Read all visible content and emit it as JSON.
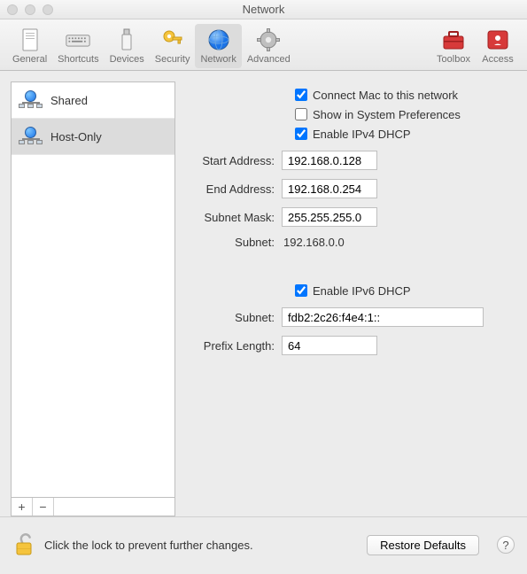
{
  "window": {
    "title": "Network"
  },
  "toolbar": {
    "items": [
      {
        "label": "General"
      },
      {
        "label": "Shortcuts"
      },
      {
        "label": "Devices"
      },
      {
        "label": "Security"
      },
      {
        "label": "Network"
      },
      {
        "label": "Advanced"
      }
    ],
    "right": [
      {
        "label": "Toolbox"
      },
      {
        "label": "Access"
      }
    ]
  },
  "sidebar": {
    "items": [
      {
        "label": "Shared"
      },
      {
        "label": "Host-Only"
      }
    ],
    "add": "+",
    "remove": "−"
  },
  "checkboxes": {
    "connect_mac": "Connect Mac to this network",
    "show_sysprefs": "Show in System Preferences",
    "enable_ipv4": "Enable IPv4 DHCP",
    "enable_ipv6": "Enable IPv6 DHCP"
  },
  "labels": {
    "start_address": "Start Address:",
    "end_address": "End Address:",
    "subnet_mask": "Subnet Mask:",
    "subnet": "Subnet:",
    "subnet6": "Subnet:",
    "prefix_length": "Prefix Length:"
  },
  "values": {
    "start_address": "192.168.0.128",
    "end_address": "192.168.0.254",
    "subnet_mask": "255.255.255.0",
    "subnet": "192.168.0.0",
    "subnet6": "fdb2:2c26:f4e4:1::",
    "prefix_length": "64"
  },
  "footer": {
    "lock_text": "Click the lock to prevent further changes.",
    "restore": "Restore Defaults",
    "help": "?"
  }
}
